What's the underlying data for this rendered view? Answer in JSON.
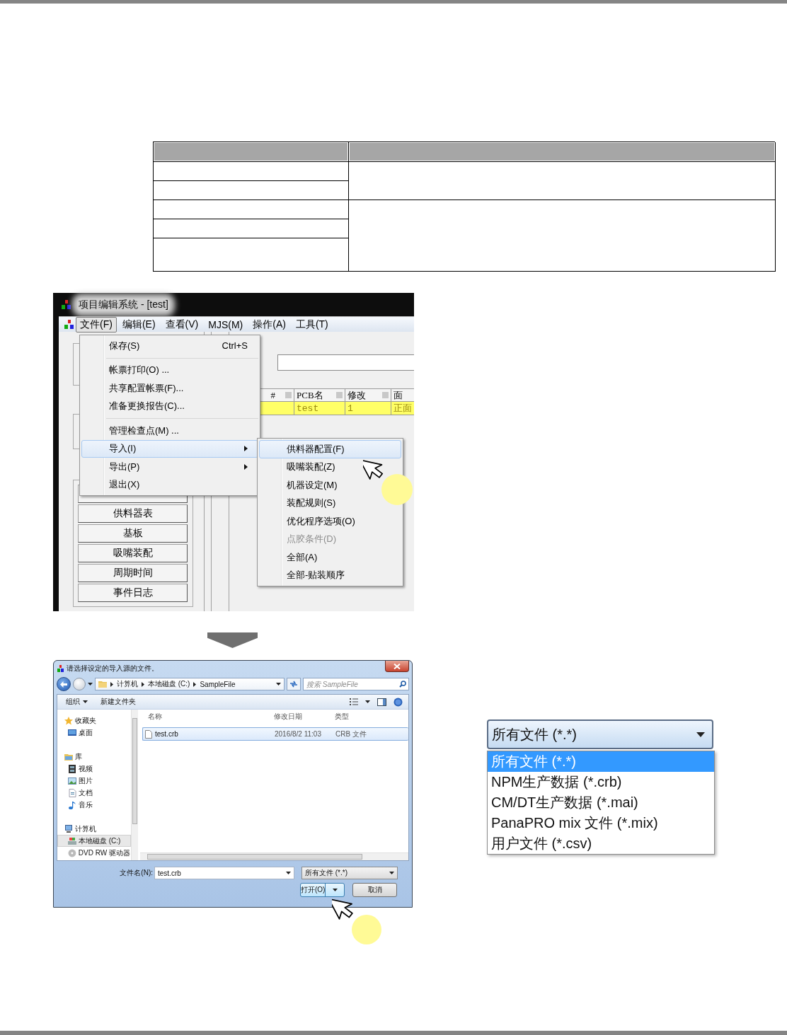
{
  "app_window": {
    "title": "项目编辑系统 - [test]",
    "menu_bar": [
      {
        "label": "文件(F)",
        "selected": true
      },
      {
        "label": "编辑(E)",
        "selected": false
      },
      {
        "label": "查看(V)",
        "selected": false
      },
      {
        "label": "MJS(M)",
        "selected": false
      },
      {
        "label": "操作(A)",
        "selected": false
      },
      {
        "label": "工具(T)",
        "selected": false
      }
    ],
    "grid": {
      "columns": [
        "#",
        "PCB名",
        "修改",
        "面"
      ],
      "rows": [
        {
          "cells": [
            "",
            "test",
            "1",
            "正面"
          ]
        }
      ]
    },
    "side_buttons": [
      "供料器表",
      "基板",
      "吸嘴装配",
      "周期时间",
      "事件日志"
    ],
    "file_menu": [
      {
        "kind": "item",
        "label": "保存(S)",
        "shortcut": "Ctrl+S",
        "selected": false
      },
      {
        "kind": "separator"
      },
      {
        "kind": "item",
        "label": "帐票打印(O) ...",
        "selected": false
      },
      {
        "kind": "item",
        "label": "共享配置帐票(F)...",
        "selected": false
      },
      {
        "kind": "item",
        "label": "准备更换报告(C)...",
        "selected": false
      },
      {
        "kind": "separator"
      },
      {
        "kind": "item",
        "label": "管理检查点(M) ...",
        "selected": false
      },
      {
        "kind": "submenu",
        "label": "导入(I)",
        "selected": true
      },
      {
        "kind": "submenu",
        "label": "导出(P)",
        "selected": false
      },
      {
        "kind": "item",
        "label": "退出(X)",
        "selected": false
      }
    ],
    "import_submenu": [
      {
        "label": "供料器配置(F)",
        "selected": true,
        "disabled": false
      },
      {
        "label": "吸嘴装配(Z)",
        "selected": false,
        "disabled": false
      },
      {
        "label": "机器设定(M)",
        "selected": false,
        "disabled": false
      },
      {
        "label": "装配规则(S)",
        "selected": false,
        "disabled": false
      },
      {
        "label": "优化程序选项(O)",
        "selected": false,
        "disabled": false
      },
      {
        "label": "点胶条件(D)",
        "selected": false,
        "disabled": true
      },
      {
        "label": "全部(A)",
        "selected": false,
        "disabled": false
      },
      {
        "label": "全部-贴装顺序",
        "selected": false,
        "disabled": false
      }
    ]
  },
  "dialog": {
    "title": "请选择设定的导入源的文件。",
    "path": [
      "计算机",
      "本地磁盘 (C:)",
      "SampleFile"
    ],
    "search": {
      "placeholder": "搜索 SampleFile"
    },
    "toolbar": [
      "组织",
      "新建文件夹"
    ],
    "nav": [
      {
        "label": "收藏夹",
        "children": [
          {
            "label": "桌面",
            "selected": false
          }
        ]
      },
      {
        "label": "库",
        "children": [
          {
            "label": "视频",
            "selected": false
          },
          {
            "label": "图片",
            "selected": false
          },
          {
            "label": "文档",
            "selected": false
          },
          {
            "label": "音乐",
            "selected": false
          }
        ]
      },
      {
        "label": "计算机",
        "children": [
          {
            "label": "本地磁盘 (C:)",
            "selected": true
          },
          {
            "label": "DVD RW 驱动器",
            "selected": false
          }
        ]
      }
    ],
    "columns": [
      "名称",
      "修改日期",
      "类型"
    ],
    "files": [
      {
        "cells": [
          "test.crb",
          "2016/8/2 11:03",
          "CRB 文件"
        ],
        "selected": true
      }
    ],
    "file_name_label": "文件名(N):",
    "file_name": "test.crb",
    "filter": "所有文件 (*.*)",
    "open_button": "打开(O)",
    "cancel_button": "取消"
  },
  "filter_dropdown": {
    "value": "所有文件 (*.*)",
    "options": [
      {
        "label": "所有文件 (*.*)",
        "selected": true
      },
      {
        "label": "NPM生产数据 (*.crb)",
        "selected": false
      },
      {
        "label": "CM/DT生产数据 (*.mai)",
        "selected": false
      },
      {
        "label": "PanaPRO mix 文件 (*.mix)",
        "selected": false
      },
      {
        "label": "用户文件 (*.csv)",
        "selected": false
      }
    ]
  }
}
